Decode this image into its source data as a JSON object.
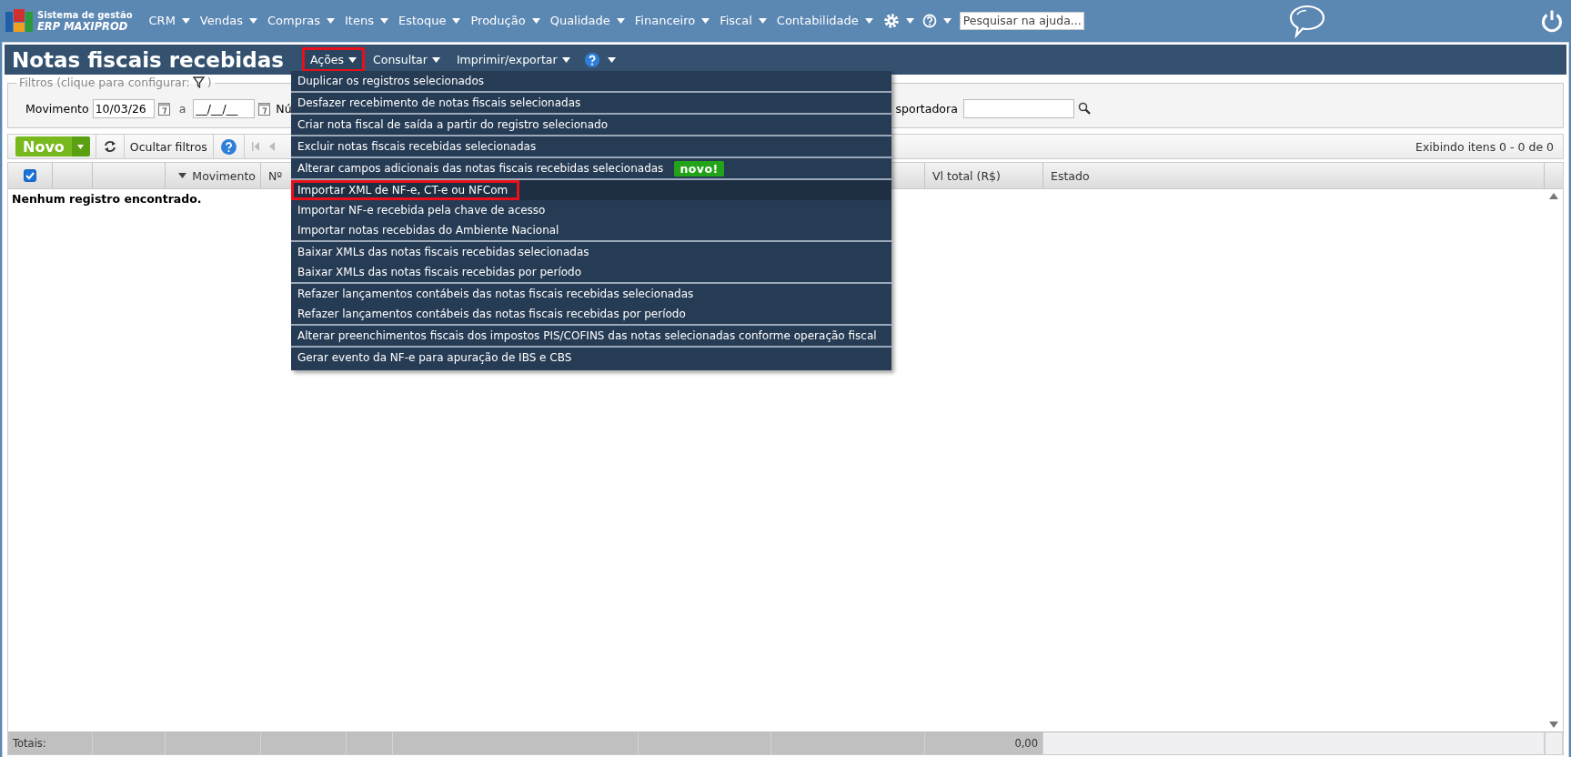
{
  "topbar": {
    "logo_line1": "Sistema de gestão",
    "logo_line2": "ERP MAXIPROD",
    "menus": [
      "CRM",
      "Vendas",
      "Compras",
      "Itens",
      "Estoque",
      "Produção",
      "Qualidade",
      "Financeiro",
      "Fiscal",
      "Contabilidade"
    ],
    "search": {
      "placeholder": "Pesquisar na ajuda..."
    }
  },
  "page": {
    "title": "Notas fiscais recebidas",
    "actions": [
      {
        "label": "Ações",
        "selected": true,
        "outlined": true
      },
      {
        "label": "Consultar",
        "selected": false,
        "outlined": false
      },
      {
        "label": "Imprimir/exportar",
        "selected": false,
        "outlined": false
      }
    ]
  },
  "filters": {
    "legend": "Filtros (clique para configurar:",
    "legend_end": ")",
    "movimento": {
      "label": "Movimento",
      "from": "10/03/26",
      "to_label": "a",
      "to": "__/__/__"
    },
    "partial_label": "Nú",
    "transportadora_label": "sportadora"
  },
  "toolbar": {
    "new_button": "Novo",
    "hide_filters": "Ocultar filtros",
    "status": "Exibindo itens 0 - 0 de 0"
  },
  "table": {
    "columns": [
      {
        "kind": "check",
        "checked": true
      },
      {
        "kind": "blank"
      },
      {
        "kind": "blank"
      },
      {
        "kind": "text",
        "label": "Movimento",
        "sorted": true
      },
      {
        "kind": "text",
        "label": "Nº",
        "sorted": false
      },
      {
        "kind": "blank"
      },
      {
        "kind": "blank"
      },
      {
        "kind": "blank"
      },
      {
        "kind": "blank"
      },
      {
        "kind": "text",
        "label": "Vl total (R$)",
        "sorted": false
      },
      {
        "kind": "text",
        "label": "Estado",
        "sorted": false
      }
    ],
    "empty_message": "Nenhum registro encontrado.",
    "totals": {
      "label": "Totais:",
      "value": "0,00"
    }
  },
  "dropdown": {
    "groups": [
      {
        "items": [
          {
            "text": "Duplicar os registros selecionados",
            "highlighted": false,
            "outlined": false
          }
        ]
      },
      {
        "items": [
          {
            "text": "Desfazer recebimento de notas fiscais selecionadas",
            "highlighted": false,
            "outlined": false
          }
        ]
      },
      {
        "items": [
          {
            "text": "Criar nota fiscal de saída a partir do registro selecionado",
            "highlighted": false,
            "outlined": false
          }
        ]
      },
      {
        "items": [
          {
            "text": "Excluir notas fiscais recebidas selecionadas",
            "highlighted": false,
            "outlined": false
          }
        ]
      },
      {
        "items": [
          {
            "text": "Alterar campos adicionais das notas fiscais recebidas selecionadas",
            "badge": "novo!",
            "highlighted": false,
            "outlined": false
          }
        ]
      },
      {
        "items": [
          {
            "text": "Importar XML de NF-e, CT-e ou NFCom",
            "highlighted": true,
            "outlined": true
          },
          {
            "text": "Importar NF-e recebida pela chave de acesso",
            "highlighted": false,
            "outlined": false
          },
          {
            "text": "Importar notas recebidas do Ambiente Nacional",
            "highlighted": false,
            "outlined": false
          }
        ]
      },
      {
        "items": [
          {
            "text": "Baixar XMLs das notas fiscais recebidas selecionadas",
            "highlighted": false,
            "outlined": false
          },
          {
            "text": "Baixar XMLs das notas fiscais recebidas por período",
            "highlighted": false,
            "outlined": false
          }
        ]
      },
      {
        "items": [
          {
            "text": "Refazer lançamentos contábeis das notas fiscais recebidas selecionadas",
            "highlighted": false,
            "outlined": false
          },
          {
            "text": "Refazer lançamentos contábeis das notas fiscais recebidas por período",
            "highlighted": false,
            "outlined": false
          }
        ]
      },
      {
        "items": [
          {
            "text": "Alterar preenchimentos fiscais dos impostos PIS/COFINS das notas selecionadas conforme operação fiscal",
            "highlighted": false,
            "outlined": false
          }
        ]
      },
      {
        "items": [
          {
            "text": "Gerar evento da NF-e para apuração de IBS e CBS",
            "highlighted": false,
            "outlined": false
          }
        ]
      }
    ]
  }
}
